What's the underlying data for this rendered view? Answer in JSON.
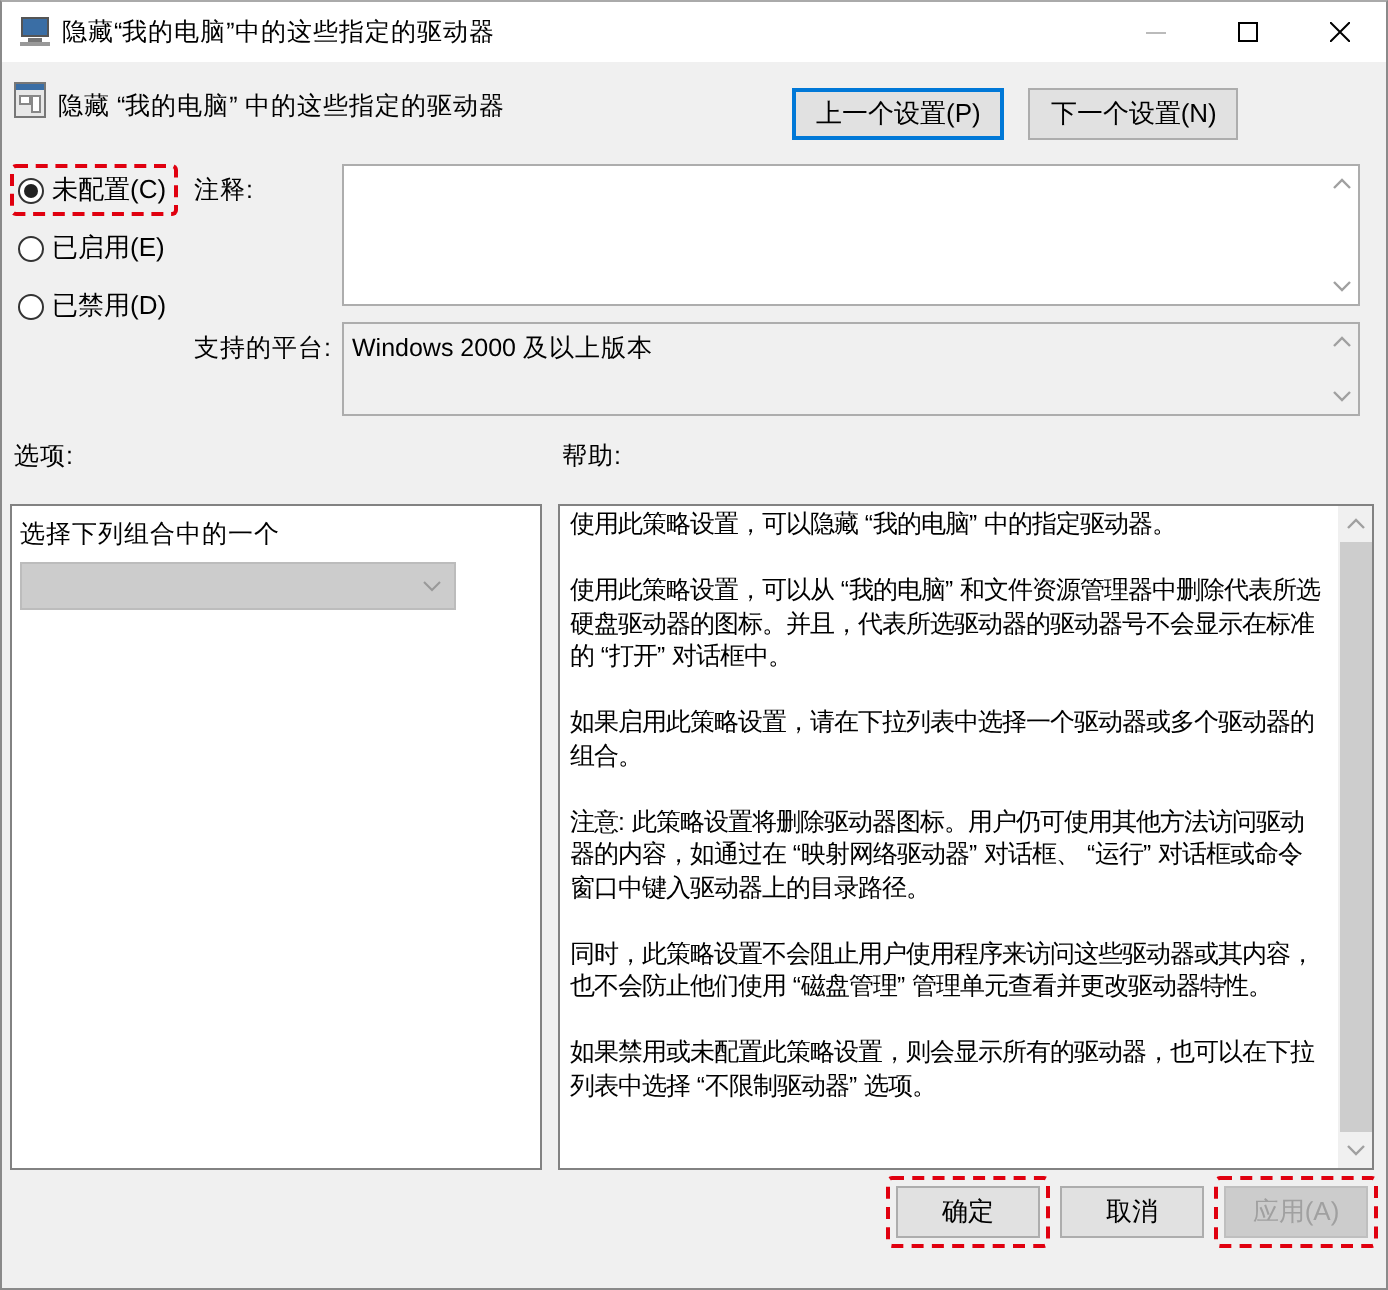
{
  "window": {
    "title": "隐藏“我的电脑”中的这些指定的驱动器"
  },
  "header": {
    "title": "隐藏 “我的电脑” 中的这些指定的驱动器",
    "buttons": [
      {
        "label": "上一个设置(P)",
        "default": true
      },
      {
        "label": "下一个设置(N)",
        "default": false
      }
    ]
  },
  "states": [
    {
      "label": "未配置(C)",
      "selected": true,
      "highlighted": true
    },
    {
      "label": "已启用(E)",
      "selected": false,
      "highlighted": false
    },
    {
      "label": "已禁用(D)",
      "selected": false,
      "highlighted": false
    }
  ],
  "comment": {
    "label": "注释:"
  },
  "platform": {
    "label": "支持的平台:",
    "value": "Windows 2000 及以上版本"
  },
  "options": {
    "label": "选项:",
    "prompt": "选择下列组合中的一个",
    "dropdown": {
      "disabled": true
    }
  },
  "help": {
    "label": "帮助:",
    "paragraphs": [
      "使用此策略设置，可以隐藏 “我的电脑” 中的指定驱动器。",
      "使用此策略设置，可以从 “我的电脑” 和文件资源管理器中删除代表所选硬盘驱动器的图标。并且，代表所选驱动器的驱动器号不会显示在标准的 “打开” 对话框中。",
      "如果启用此策略设置，请在下拉列表中选择一个驱动器或多个驱动器的组合。",
      "注意: 此策略设置将删除驱动器图标。用户仍可使用其他方法访问驱动器的内容，如通过在 “映射网络驱动器” 对话框、 “运行” 对话框或命令窗口中键入驱动器上的目录路径。",
      "同时，此策略设置不会阻止用户使用程序来访问这些驱动器或其内容，也不会防止他们使用 “磁盘管理” 管理单元查看并更改驱动器特性。",
      "如果禁用或未配置此策略设置，则会显示所有的驱动器，也可以在下拉列表中选择 “不限制驱动器” 选项。"
    ]
  },
  "buttons": [
    {
      "label": "确定",
      "disabled": false,
      "highlighted": true
    },
    {
      "label": "取消",
      "disabled": false,
      "highlighted": false
    },
    {
      "label": "应用(A)",
      "disabled": true,
      "highlighted": true
    }
  ]
}
